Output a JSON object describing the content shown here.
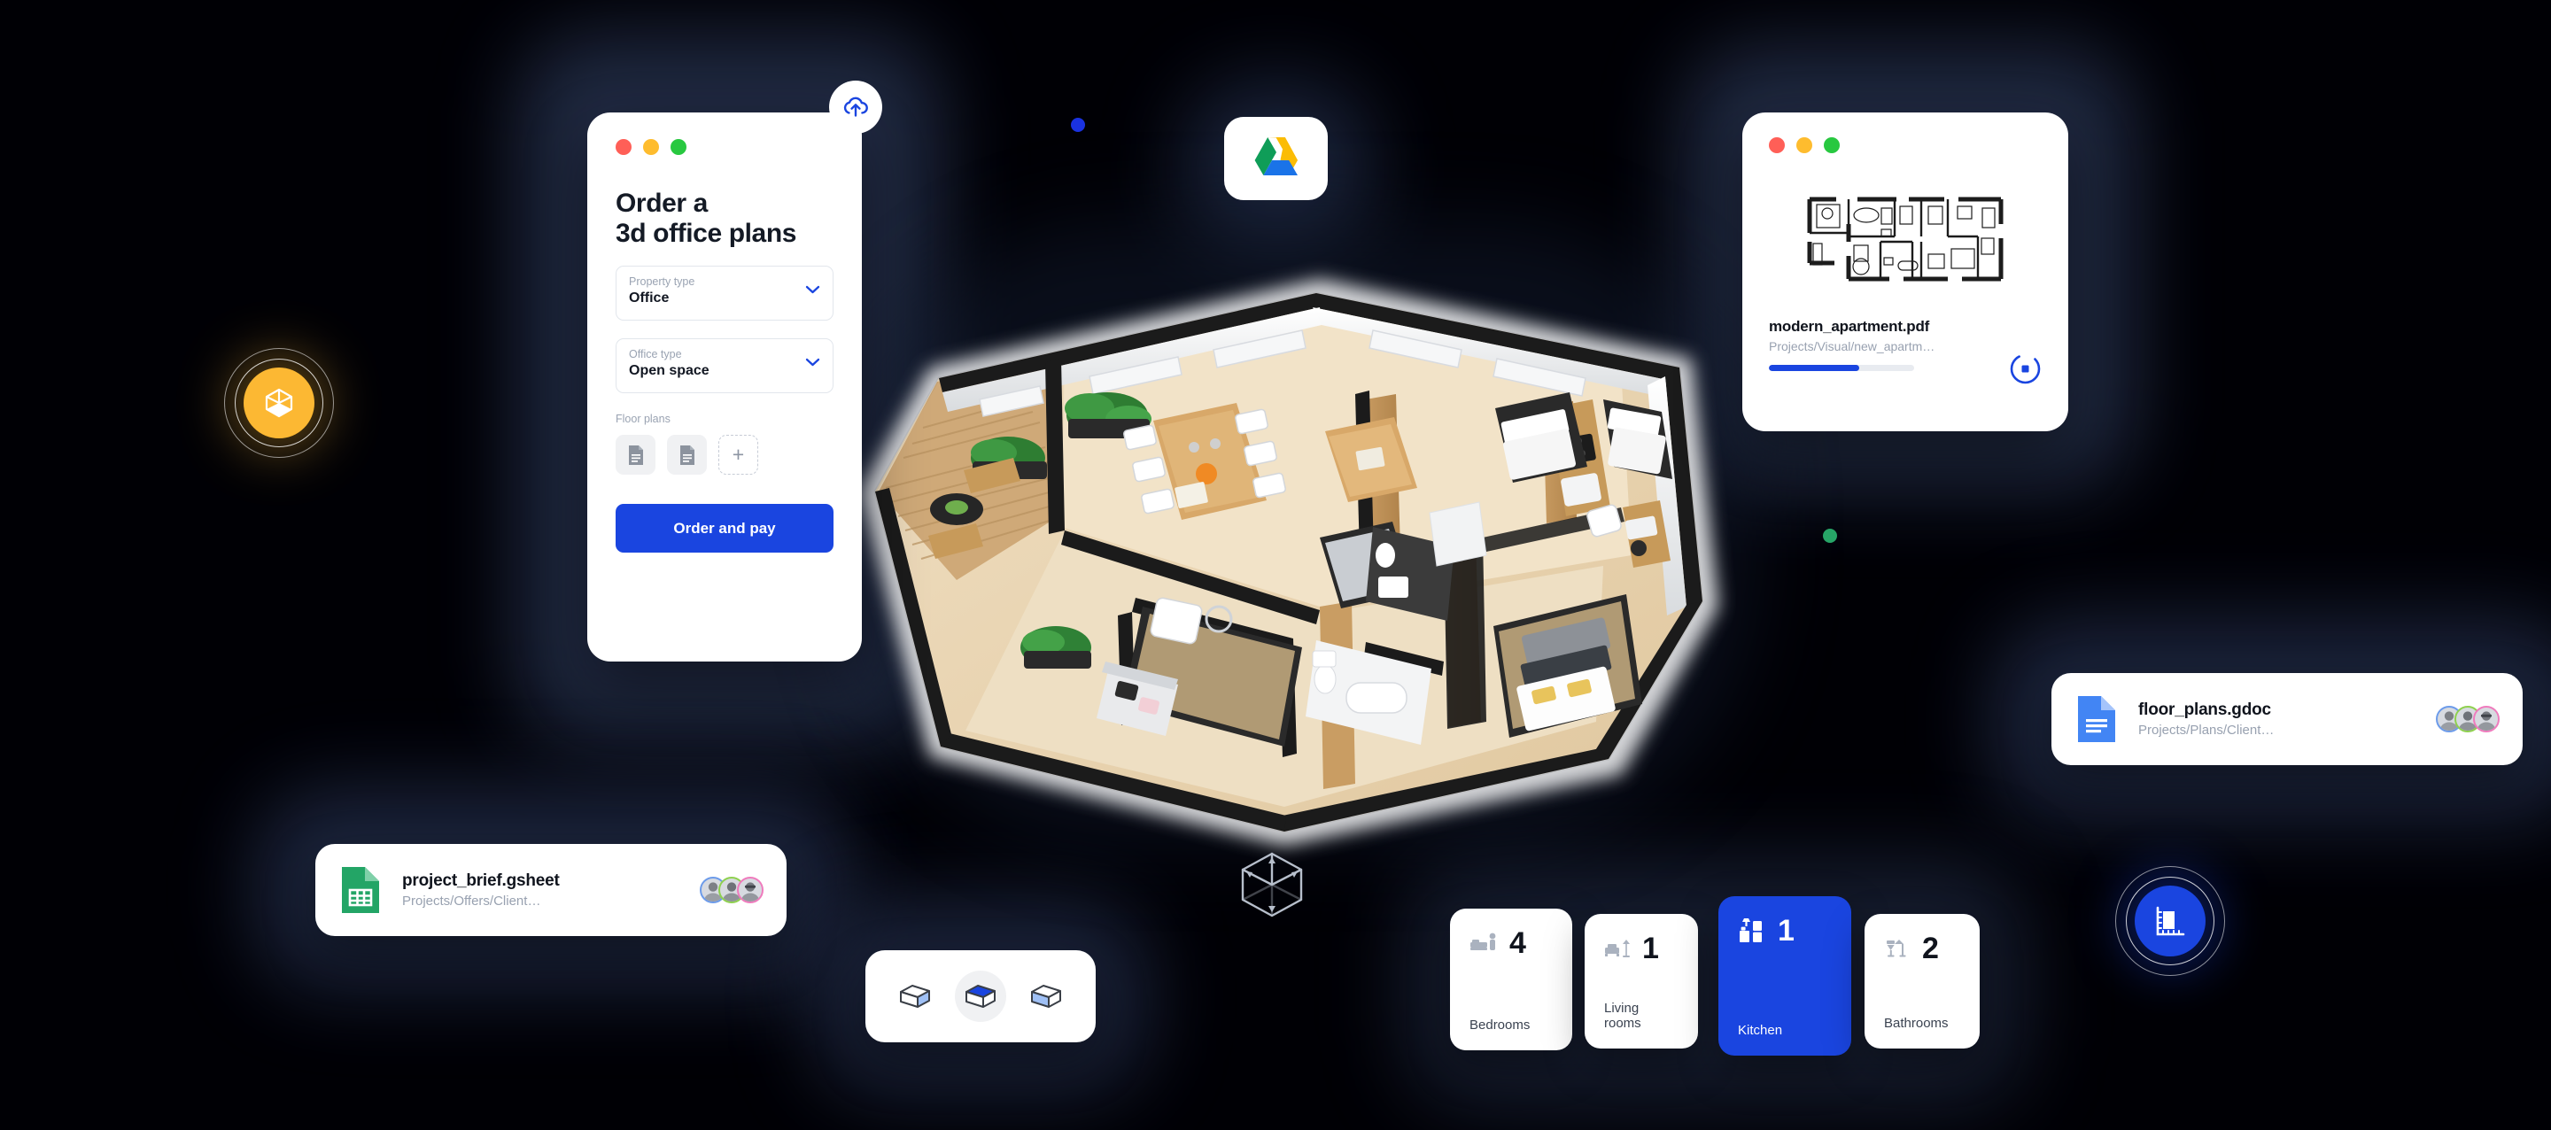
{
  "theme": {
    "background": "#000005",
    "halo": "#2b3550",
    "accent": "#1a45e0",
    "yellow": "#fcb833",
    "green_dot": "#27a567",
    "blue_dot": "#1a32e0"
  },
  "upload_badge": {
    "icon": "cloud-upload-icon"
  },
  "drive_badge": {
    "icon": "google-drive-icon"
  },
  "order_card": {
    "window_dots": [
      "red",
      "yellow",
      "green"
    ],
    "title_line1": "Order a",
    "title_line2": "3d office plans",
    "fields": [
      {
        "label": "Property type",
        "value": "Office",
        "icon": "chevron-down-icon"
      },
      {
        "label": "Office type",
        "value": "Open space",
        "icon": "chevron-down-icon"
      }
    ],
    "floor_plans_label": "Floor plans",
    "thumbs": [
      {
        "icon": "document-icon"
      },
      {
        "icon": "document-icon"
      },
      {
        "icon": "plus-icon",
        "label": "+"
      }
    ],
    "cta_label": "Order and pay"
  },
  "pdf_card": {
    "window_dots": [
      "red",
      "yellow",
      "green"
    ],
    "preview_icon": "floorplan-blueprint",
    "file_name": "modern_apartment.pdf",
    "file_path": "Projects/Visual/new_apartm…",
    "progress_percent": 62,
    "stop_button_icon": "stop-icon"
  },
  "file_pills": [
    {
      "id": "gsheet",
      "icon": "google-sheets-icon",
      "icon_color": "#23a566",
      "name": "project_brief.gsheet",
      "path": "Projects/Offers/Client…",
      "avatars": [
        "avatar-blue",
        "avatar-green",
        "avatar-pink"
      ]
    },
    {
      "id": "gdoc",
      "icon": "google-docs-icon",
      "icon_color": "#4285f4",
      "name": "floor_plans.gdoc",
      "path": "Projects/Plans/Client…",
      "avatars": [
        "avatar-blue",
        "avatar-green",
        "avatar-pink"
      ]
    }
  ],
  "view_toggle": {
    "options": [
      {
        "name": "view-3d-side",
        "active": false
      },
      {
        "name": "view-3d-top",
        "active": true
      },
      {
        "name": "view-3d-front",
        "active": false
      }
    ]
  },
  "stats": [
    {
      "id": "bedrooms",
      "icon": "bed-icon",
      "value": "4",
      "label": "Bedrooms",
      "active": false
    },
    {
      "id": "living",
      "icon": "sofa-lamp-icon",
      "value": "1",
      "label": "Living rooms",
      "active": false
    },
    {
      "id": "kitchen",
      "icon": "kitchen-icon",
      "value": "1",
      "label": "Kitchen",
      "active": true
    },
    {
      "id": "bathrooms",
      "icon": "bathroom-icon",
      "value": "2",
      "label": "Bathrooms",
      "active": false
    }
  ],
  "round_icons": [
    {
      "id": "3d-cube",
      "icon": "cube-icon",
      "color": "#fcb833"
    },
    {
      "id": "measure",
      "icon": "measure-icon",
      "color": "#1a45e0"
    }
  ],
  "axis_cube": {
    "icon": "axis-cube-icon"
  },
  "floorplan": {
    "name": "3d-floorplan-render",
    "alt": "Isometric 3D apartment floor plan render"
  },
  "mini_dots": [
    {
      "name": "dot-blue",
      "color": "#1a32e0"
    },
    {
      "name": "dot-green",
      "color": "#27a567"
    }
  ]
}
